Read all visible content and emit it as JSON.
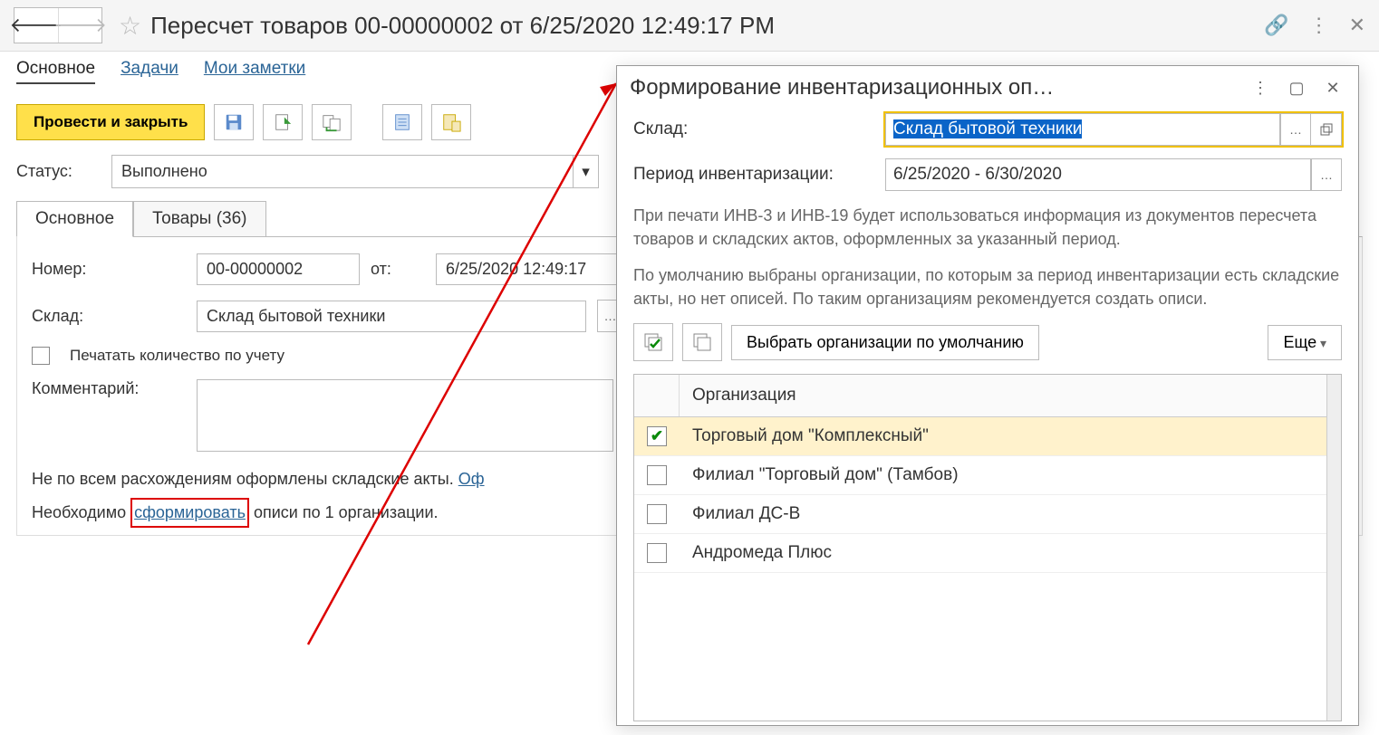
{
  "header": {
    "title": "Пересчет товаров 00-00000002 от 6/25/2020 12:49:17 PM"
  },
  "nav": {
    "main": "Основное",
    "tasks": "Задачи",
    "notes": "Мои заметки"
  },
  "toolbar": {
    "post_and_close": "Провести и закрыть"
  },
  "status": {
    "label": "Статус:",
    "value": "Выполнено"
  },
  "tabs": {
    "main": "Основное",
    "goods": "Товары (36)"
  },
  "form": {
    "number_label": "Номер:",
    "number_value": "00-00000002",
    "date_label": "от:",
    "date_value": "6/25/2020 12:49:17",
    "warehouse_label": "Склад:",
    "warehouse_value": "Склад бытовой техники",
    "print_qty_label": "Печатать количество по учету",
    "comment_label": "Комментарий:"
  },
  "notice": {
    "line1_pre": "Не по всем расхождениям оформлены складские акты. ",
    "line1_link": "Оф",
    "line2_pre": "Необходимо ",
    "line2_link": "сформировать",
    "line2_post": " описи по 1 организации."
  },
  "popup": {
    "title": "Формирование инвентаризационных оп…",
    "warehouse_label": "Склад:",
    "warehouse_value": "Склад бытовой техники",
    "period_label": "Период инвентаризации:",
    "period_value": "6/25/2020 - 6/30/2020",
    "desc1": "При печати ИНВ-3 и ИНВ-19 будет использоваться информация из документов пересчета товаров и складских актов, оформленных за указанный период.",
    "desc2": "По умолчанию выбраны организации, по которым за период инвентаризации есть складские акты, но нет описей. По таким организациям рекомендуется создать описи.",
    "default_orgs_btn": "Выбрать организации по умолчанию",
    "more_btn": "Еще",
    "org_header": "Организация",
    "orgs": [
      {
        "name": "Торговый дом \"Комплексный\"",
        "checked": true,
        "selected": true
      },
      {
        "name": "Филиал \"Торговый дом\" (Тамбов)",
        "checked": false,
        "selected": false
      },
      {
        "name": "Филиал ДС-В",
        "checked": false,
        "selected": false
      },
      {
        "name": "Андромеда Плюс",
        "checked": false,
        "selected": false
      }
    ]
  }
}
